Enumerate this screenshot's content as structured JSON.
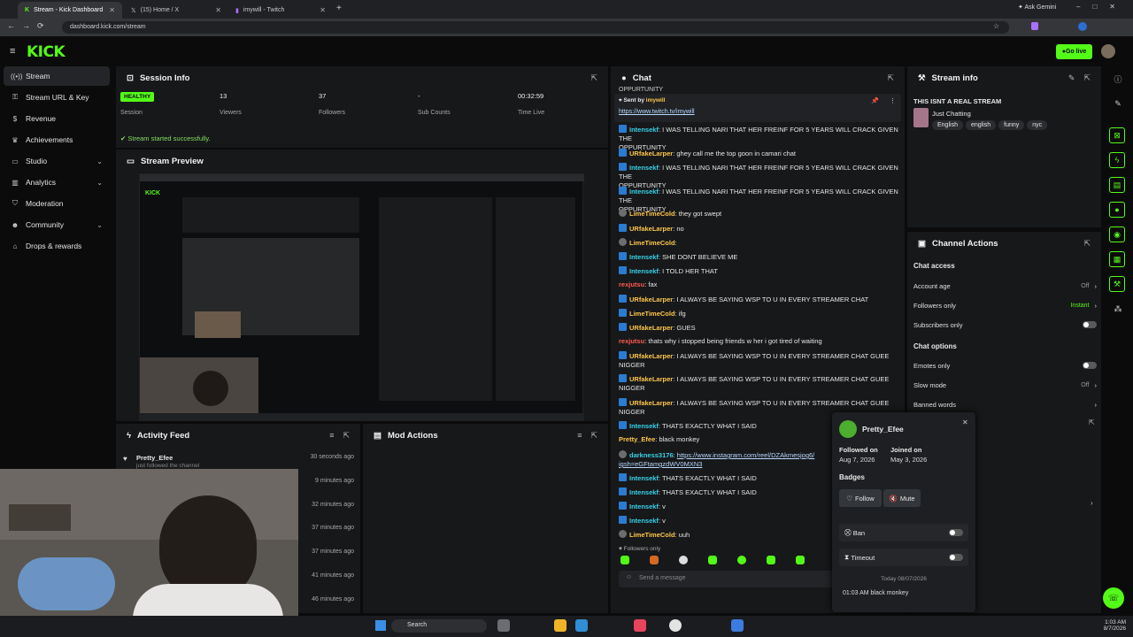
{
  "browser": {
    "tabs": [
      {
        "title": "Stream - Kick Dashboard",
        "active": true
      },
      {
        "title": "(15) Home / X"
      },
      {
        "title": "imywill - Twitch"
      }
    ],
    "url": "dashboard.kick.com/stream",
    "ask": "Ask Gemini"
  },
  "header": {
    "logo": "KICK",
    "go_live": "Go live"
  },
  "sidebar": {
    "items": [
      {
        "label": "Stream",
        "icon": "broadcast-icon",
        "active": true
      },
      {
        "label": "Stream URL & Key",
        "icon": "key-icon"
      },
      {
        "label": "Revenue",
        "icon": "dollar-icon"
      },
      {
        "label": "Achievements",
        "icon": "trophy-icon"
      },
      {
        "label": "Studio",
        "icon": "monitor-icon",
        "expand": true
      },
      {
        "label": "Analytics",
        "icon": "chart-icon",
        "expand": true
      },
      {
        "label": "Moderation",
        "icon": "shield-icon"
      },
      {
        "label": "Community",
        "icon": "people-icon",
        "expand": true
      },
      {
        "label": "Drops & rewards",
        "icon": "gift-icon"
      }
    ]
  },
  "session": {
    "title": "Session Info",
    "health": "HEALTHY",
    "health_label": "Session",
    "viewers": "13",
    "viewers_label": "Viewers",
    "followers": "37",
    "followers_label": "Followers",
    "subs": "-",
    "subs_label": "Sub Counts",
    "time": "00:32:59",
    "time_label": "Time Live",
    "status": "Stream started successfully."
  },
  "preview": {
    "title": "Stream Preview"
  },
  "activity": {
    "title": "Activity Feed",
    "items": [
      {
        "name": "Pretty_Efee",
        "sub": "just followed the channel",
        "time": "30 seconds ago"
      },
      {
        "time": "9 minutes ago"
      },
      {
        "time": "32 minutes ago"
      },
      {
        "time": "37 minutes ago"
      },
      {
        "time": "37 minutes ago"
      },
      {
        "time": "41 minutes ago"
      },
      {
        "time": "46 minutes ago"
      }
    ]
  },
  "mod": {
    "title": "Mod Actions"
  },
  "chat": {
    "title": "Chat",
    "pinned_by": "Sent by",
    "pinned_user": "imywill",
    "pinned_link": "https://www.twitch.tv/imywill",
    "top_cut": "OPPURTUNITY",
    "messages": [
      {
        "user": "Intensekf",
        "c": "cyan",
        "b": "bd",
        "text": "I WAS TELLING NARI THAT HER FREINF FOR 5 YEARS WILL CRACK GIVEN THE",
        "cont": "OPPURTUNITY"
      },
      {
        "user": "URfakeLarper",
        "c": "ylw",
        "b": "bd",
        "text": "ghey call me the top goon in camari chat"
      },
      {
        "user": "Intensekf",
        "c": "cyan",
        "b": "bd",
        "text": "I WAS TELLING NARI THAT HER FREINF FOR 5 YEARS WILL CRACK GIVEN THE",
        "cont": "OPPURTUNITY"
      },
      {
        "user": "Intensekf",
        "c": "cyan",
        "b": "bd",
        "text": "I WAS TELLING NARI THAT HER FREINF FOR 5 YEARS WILL CRACK GIVEN THE",
        "cont": "OPPURTUNITY"
      },
      {
        "user": "LimeTimeCold",
        "c": "ylw",
        "b": "bd2",
        "text": "they got swept"
      },
      {
        "user": "URfakeLarper",
        "c": "ylw",
        "b": "bd",
        "text": "no"
      },
      {
        "user": "LimeTimeCold",
        "c": "ylw",
        "b": "bd2",
        "text": ""
      },
      {
        "user": "Intensekf",
        "c": "cyan",
        "b": "bd",
        "text": "SHE DONT BELIEVE ME"
      },
      {
        "user": "Intensekf",
        "c": "cyan",
        "b": "bd",
        "text": "I TOLD HER THAT"
      },
      {
        "user": "rexjutsu",
        "c": "red",
        "b": "",
        "text": "fax"
      },
      {
        "user": "URfakeLarper",
        "c": "ylw",
        "b": "bd",
        "text": "I ALWAYS BE SAYING WSP TO U IN EVERY STREAMER CHAT"
      },
      {
        "user": "LimeTimeCold",
        "c": "ylw",
        "b": "bd",
        "text": "ifg"
      },
      {
        "user": "URfakeLarper",
        "c": "ylw",
        "b": "bd",
        "text": "GUES"
      },
      {
        "user": "rexjutsu",
        "c": "red",
        "b": "",
        "text": "thats why i stopped being friends w her i got tired of waiting"
      },
      {
        "user": "URfakeLarper",
        "c": "ylw",
        "b": "bd",
        "text": "I ALWAYS BE SAYING WSP TO U IN EVERY STREAMER CHAT GUEE",
        "cont": "NIGGER"
      },
      {
        "user": "URfakeLarper",
        "c": "ylw",
        "b": "bd",
        "text": "I ALWAYS BE SAYING WSP TO U IN EVERY STREAMER CHAT GUEE",
        "cont": "NIGGER"
      },
      {
        "user": "URfakeLarper",
        "c": "ylw",
        "b": "bd",
        "text": "I ALWAYS BE SAYING WSP TO U IN EVERY STREAMER CHAT GUEE",
        "cont": "NIGGER"
      },
      {
        "user": "Intensekf",
        "c": "cyan",
        "b": "bd",
        "text": "THATS EXACTLY WHAT I SAID"
      },
      {
        "user": "Pretty_Efee",
        "c": "ylw",
        "b": "",
        "text": "black monkey"
      },
      {
        "user": "darkness3176",
        "c": "cyan",
        "b": "bd2",
        "text": "",
        "link": "https://www.instagram.com/reel/DZAkmesjog6/",
        "cont": "igsh=eGFtamgzdWV0MXN3"
      },
      {
        "user": "Intensekf",
        "c": "cyan",
        "b": "bd",
        "text": "THATS EXACTLY WHAT I SAID"
      },
      {
        "user": "Intensekf",
        "c": "cyan",
        "b": "bd",
        "text": "THATS EXACTLY WHAT I SAID"
      },
      {
        "user": "Intensekf",
        "c": "cyan",
        "b": "bd",
        "text": "v"
      },
      {
        "user": "Intensekf",
        "c": "cyan",
        "b": "bd",
        "text": "v"
      },
      {
        "user": "LimeTimeCold",
        "c": "ylw",
        "b": "bd2",
        "text": "uuh"
      }
    ],
    "followers_only": "Followers only",
    "placeholder": "Send a message"
  },
  "stream_info": {
    "title": "Stream info",
    "stream_title": "THIS ISNT A REAL STREAM",
    "category": "Just Chatting",
    "tags": [
      "English",
      "english",
      "funny",
      "nyc"
    ]
  },
  "channel_actions": {
    "title": "Channel Actions",
    "chat_access": "Chat access",
    "account_age": "Account age",
    "account_age_val": "Off",
    "followers_only": "Followers only",
    "followers_only_val": "Instant",
    "subscribers_only": "Subscribers only",
    "chat_options": "Chat options",
    "emotes_only": "Emotes only",
    "slow_mode": "Slow mode",
    "slow_mode_val": "Off",
    "banned_words": "Banned words"
  },
  "popup": {
    "name": "Pretty_Efee",
    "followed_on": "Followed on",
    "followed_date": "Aug 7, 2026",
    "joined_on": "Joined on",
    "joined_date": "May 3, 2026",
    "badges": "Badges",
    "follow": "Follow",
    "mute": "Mute",
    "ban": "Ban",
    "timeout": "Timeout",
    "day": "Today 08/07/2026",
    "log": "01:03 AM black monkey"
  },
  "taskbar": {
    "search": "Search",
    "time": "1:03 AM",
    "date": "8/7/2026"
  },
  "colors": {
    "brand": "#53fc18",
    "panel": "#17181a",
    "bg": "#0b0b0c"
  }
}
